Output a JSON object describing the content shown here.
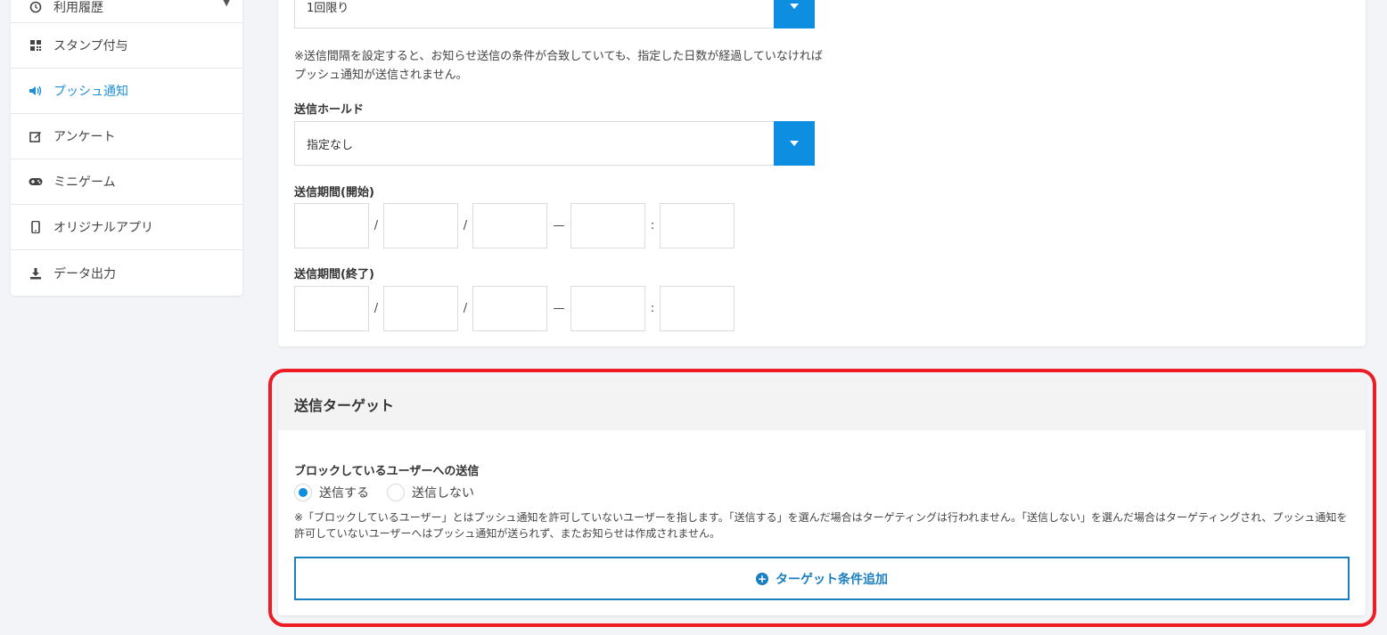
{
  "sidebar": {
    "items": [
      {
        "label": "利用履歴",
        "icon": "history-icon"
      },
      {
        "label": "スタンプ付与",
        "icon": "qr-grid-icon"
      },
      {
        "label": "プッシュ通知",
        "icon": "megaphone-icon"
      },
      {
        "label": "アンケート",
        "icon": "edit-icon"
      },
      {
        "label": "ミニゲーム",
        "icon": "gamepad-icon"
      },
      {
        "label": "オリジナルアプリ",
        "icon": "mobile-icon"
      },
      {
        "label": "データ出力",
        "icon": "download-icon"
      }
    ],
    "active_color": "#1f8fd6"
  },
  "settings": {
    "interval_select_value": "1回限り",
    "interval_note": "※送信間隔を設定すると、お知らせ送信の条件が合致していても、指定した日数が経過していなければプッシュ通知が送信されません。",
    "hold_label": "送信ホールド",
    "hold_select_value": "指定なし",
    "period_start_label": "送信期間(開始)",
    "period_end_label": "送信期間(終了)",
    "date_sep": "/",
    "range_sep": "—",
    "time_sep": ":"
  },
  "target": {
    "title": "送信ターゲット",
    "blocked_label": "ブロックしているユーザーへの送信",
    "options": [
      {
        "label": "送信する",
        "selected": true
      },
      {
        "label": "送信しない",
        "selected": false
      }
    ],
    "note": "※「ブロックしているユーザー」とはプッシュ通知を許可していないユーザーを指します。「送信する」を選んだ場合はターゲティングは行われません。「送信しない」を選んだ場合はターゲティングされ、プッシュ通知を許可していないユーザーへはプッシュ通知が送られず、またお知らせは作成されません。",
    "add_button_label": "ターゲット条件追加"
  },
  "colors": {
    "accent": "#0d8ee0",
    "highlight_border": "#ee1c25",
    "button_border": "#1a7fc1"
  }
}
